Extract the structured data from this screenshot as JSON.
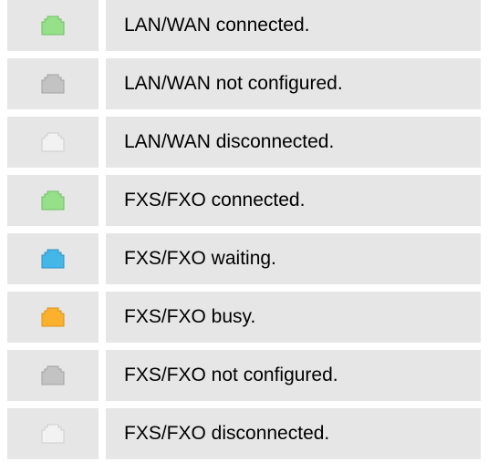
{
  "legend": {
    "rows": [
      {
        "label": "LAN/WAN connected.",
        "icon": "port-connected-icon",
        "fill": "#97e08a",
        "stroke": "#6fbf63"
      },
      {
        "label": "LAN/WAN not configured.",
        "icon": "port-not-configured-icon",
        "fill": "#c3c3c3",
        "stroke": "#a3a3a3"
      },
      {
        "label": "LAN/WAN disconnected.",
        "icon": "port-disconnected-icon",
        "fill": "#f2f2f2",
        "stroke": "#cfcfcf"
      },
      {
        "label": "FXS/FXO connected.",
        "icon": "port-connected-icon",
        "fill": "#97e08a",
        "stroke": "#6fbf63"
      },
      {
        "label": "FXS/FXO waiting.",
        "icon": "port-waiting-icon",
        "fill": "#44b6e8",
        "stroke": "#2f93c4"
      },
      {
        "label": "FXS/FXO busy.",
        "icon": "port-busy-icon",
        "fill": "#fbb12e",
        "stroke": "#dc9315"
      },
      {
        "label": "FXS/FXO not configured.",
        "icon": "port-not-configured-icon",
        "fill": "#c3c3c3",
        "stroke": "#a3a3a3"
      },
      {
        "label": "FXS/FXO disconnected.",
        "icon": "port-disconnected-icon",
        "fill": "#f2f2f2",
        "stroke": "#cfcfcf"
      }
    ]
  }
}
